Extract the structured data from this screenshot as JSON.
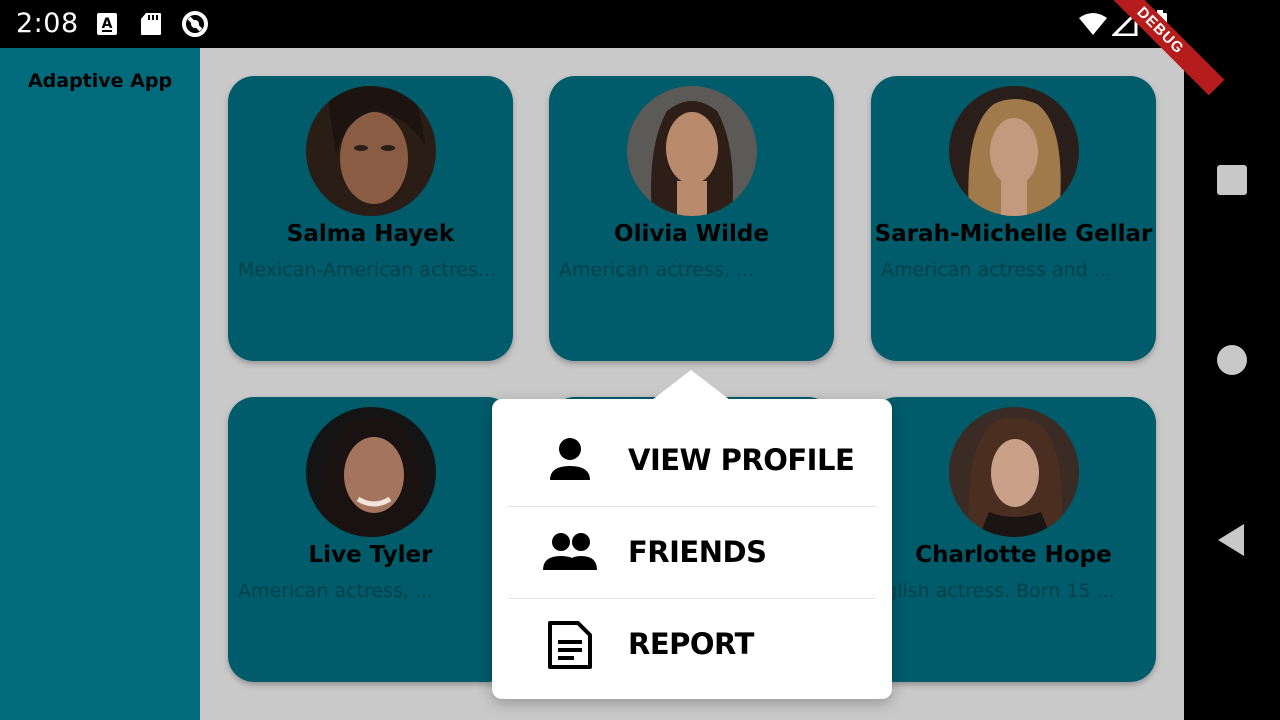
{
  "status_bar": {
    "time": "2:08",
    "debug_label": "DEBUG",
    "left_icons": [
      "font-notification-icon",
      "sd-card-icon",
      "sync-app-icon"
    ],
    "right_icons": [
      "wifi-icon",
      "signal-icon",
      "battery-icon"
    ]
  },
  "app": {
    "title": "Adaptive App"
  },
  "cards": [
    {
      "name": "Salma Hayek",
      "description": "Mexican-American actres..."
    },
    {
      "name": "Olivia Wilde",
      "description": "American actress, ..."
    },
    {
      "name": "Sarah-Michelle Gellar",
      "description": "American actress and ..."
    },
    {
      "name": "Live Tyler",
      "description": "American actress, ..."
    },
    {
      "name": "",
      "description": ""
    },
    {
      "name": "Charlotte Hope",
      "description": "nglish actress. Born 15 ..."
    }
  ],
  "popup_menu": {
    "items": [
      {
        "label": "VIEW PROFILE",
        "icon": "person-icon"
      },
      {
        "label": "FRIENDS",
        "icon": "group-icon"
      },
      {
        "label": "REPORT",
        "icon": "document-icon"
      }
    ]
  },
  "nav_bar": {
    "buttons": [
      "recents-button",
      "home-button",
      "back-button"
    ]
  },
  "colors": {
    "sidebar": "#006b7d",
    "card": "#005b6b",
    "background_scrim": "#c9c9c9",
    "debug_ribbon": "#b71c1c"
  }
}
